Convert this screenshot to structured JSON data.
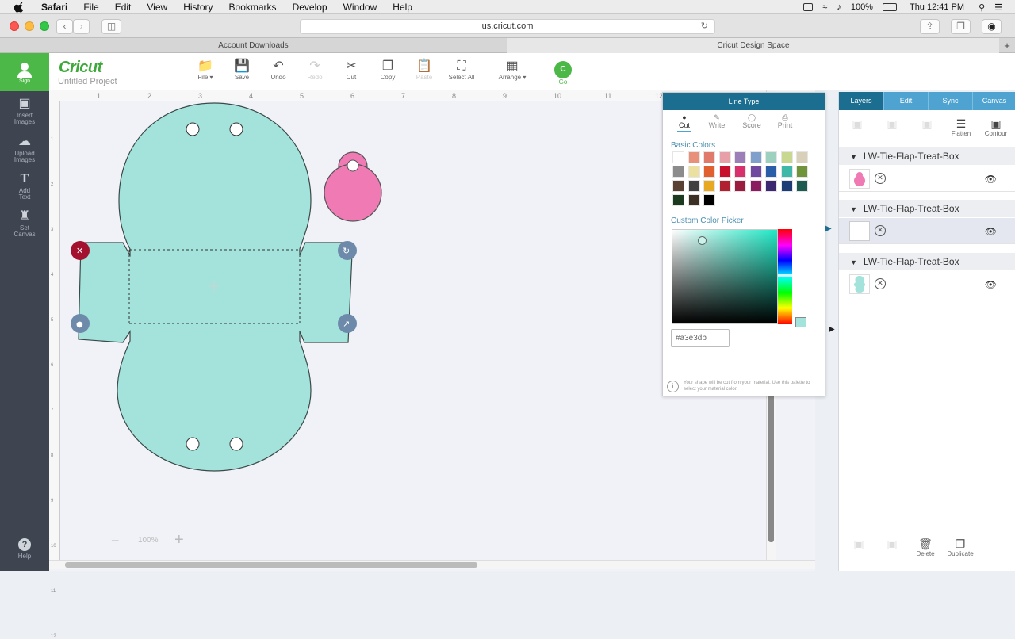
{
  "menubar": {
    "items": [
      "Safari",
      "File",
      "Edit",
      "View",
      "History",
      "Bookmarks",
      "Develop",
      "Window",
      "Help"
    ],
    "battery": "100%",
    "clock": "Thu 12:41 PM"
  },
  "safari": {
    "url": "us.cricut.com",
    "tabs": [
      "Account Downloads",
      "Cricut Design Space"
    ]
  },
  "sidebar": {
    "user_label": "Sign",
    "tools": [
      {
        "label1": "Insert",
        "label2": "Images",
        "icon": "image-icon"
      },
      {
        "label1": "Upload",
        "label2": "Images",
        "icon": "upload-icon"
      },
      {
        "label1": "Add",
        "label2": "Text",
        "icon": "text-icon"
      },
      {
        "label1": "Set",
        "label2": "Canvas",
        "icon": "shirt-icon"
      }
    ],
    "help_label": "Help"
  },
  "toolbar": {
    "logo": "Cricut",
    "project_name": "Untitled Project",
    "buttons": [
      "File",
      "Save",
      "Undo",
      "Redo",
      "Cut",
      "Copy",
      "Paste",
      "Select All",
      "Arrange"
    ],
    "go_label": "Go"
  },
  "canvas": {
    "ruler_top": [
      "1",
      "2",
      "3",
      "4",
      "5",
      "6",
      "7",
      "8",
      "9",
      "10",
      "11",
      "12"
    ],
    "ruler_left": [
      "1",
      "2",
      "3",
      "4",
      "5",
      "6",
      "7",
      "8",
      "9",
      "10",
      "11",
      "12"
    ],
    "zoom": "100%"
  },
  "line_type": {
    "header": "Line Type",
    "tabs": [
      "Cut",
      "Write",
      "Score",
      "Print"
    ],
    "active_tab": "Cut",
    "basic_colors_label": "Basic Colors",
    "basic_colors": [
      "#ffffff",
      "#e8907a",
      "#e07a6a",
      "#e8a0a8",
      "#9c7fb8",
      "#7fa0cc",
      "#9ed0c0",
      "#c8d890",
      "#d8d0b8",
      "#8c8c8c",
      "#ece0a0",
      "#e06030",
      "#c8102e",
      "#d8306c",
      "#7048a0",
      "#2a5ea8",
      "#40b8a8",
      "#70943a",
      "#5a4030",
      "#404040",
      "#e8a820",
      "#b02030",
      "#9c1c40",
      "#8c1c60",
      "#3c2870",
      "#1c3c78",
      "#1c5c50",
      "#1c3a20",
      "#3c3024",
      "#000000"
    ],
    "custom_label": "Custom Color Picker",
    "hex_value": "#a3e3db",
    "note": "Your shape will be cut from your material. Use this palette to select your material color."
  },
  "layers_panel": {
    "tabs": [
      "Layers",
      "Edit",
      "Sync",
      "Canvas"
    ],
    "active_tab": "Layers",
    "tools": [
      "Flatten",
      "Contour"
    ],
    "groups": [
      {
        "name": "LW-Tie-Flap-Treat-Box",
        "thumb_color": "#f07ab4"
      },
      {
        "name": "LW-Tie-Flap-Treat-Box",
        "thumb_color": "#ffffff"
      },
      {
        "name": "LW-Tie-Flap-Treat-Box",
        "thumb_color": "#a3e3db"
      }
    ],
    "bottom_buttons": [
      "Delete",
      "Duplicate"
    ]
  },
  "colors": {
    "accent_green": "#4cb848",
    "panel_header": "#1b6e8f",
    "tab_blue": "#4fa3d1",
    "shape_fill": "#a3e3db",
    "tag_fill": "#f07ab4"
  }
}
